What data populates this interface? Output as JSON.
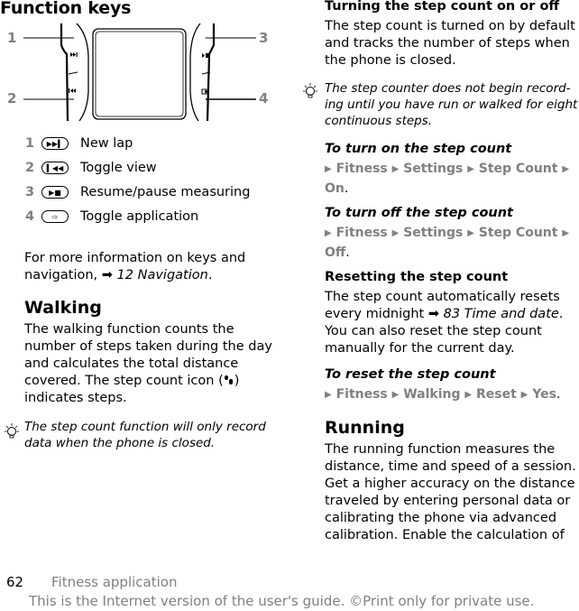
{
  "left": {
    "title": "Function keys",
    "diagram": {
      "callouts": [
        "1",
        "2",
        "3",
        "4"
      ],
      "icons": [
        "next-track-icon",
        "previous-track-icon",
        "play-pause-icon",
        "toggle-app-icon"
      ]
    },
    "keys": [
      {
        "num": "1",
        "icon": "next-track-icon",
        "glyph": "▶▶▍",
        "label": "New lap"
      },
      {
        "num": "2",
        "icon": "previous-track-icon",
        "glyph": "▍◀◀",
        "label": "Toggle view"
      },
      {
        "num": "3",
        "icon": "play-pause-icon",
        "glyph": "▶■",
        "label": "Resume/pause measuring"
      },
      {
        "num": "4",
        "icon": "toggle-app-icon",
        "glyph": "⇨",
        "label": "Toggle application"
      }
    ],
    "more_info": {
      "line1": "For more information on keys and",
      "line2_prefix": "navigation,",
      "arrow": "➡",
      "ref": "12 Navigation",
      "suffix": "."
    },
    "walking": {
      "heading": "Walking",
      "lines": [
        "The walking function counts the",
        "number of steps taken during the day",
        "and calculates the total distance"
      ],
      "line4_prefix": "covered. The step count icon (",
      "line4_suffix": ")",
      "line5": "indicates steps."
    },
    "tip": {
      "lines": [
        "The step count function will only record",
        "data when the phone is closed."
      ]
    }
  },
  "right": {
    "onoff": {
      "heading": "Turning the step count on or off",
      "lines": [
        "The step count is turned on by default",
        "and tracks the number of steps when",
        "the phone is closed."
      ]
    },
    "tip": {
      "lines": [
        "The step counter does not begin record-",
        "ing until you have run or walked for eight",
        "continuous steps."
      ]
    },
    "turn_on": {
      "heading": "To turn on the step count",
      "path": [
        "Fitness",
        "Settings",
        "Step Count"
      ],
      "final": "On"
    },
    "turn_off": {
      "heading": "To turn off the step count",
      "path": [
        "Fitness",
        "Settings",
        "Step Count"
      ],
      "final": "Off"
    },
    "resetting": {
      "heading": "Resetting the step count",
      "line1": "The step count automatically resets",
      "line2_prefix": "every midnight",
      "arrow": "➡",
      "ref": "83 Time and date",
      "line3": "You can also reset the step count",
      "line4": "manually for the current day."
    },
    "reset": {
      "heading": "To reset the step count",
      "path": [
        "Fitness",
        "Walking",
        "Reset",
        "Yes"
      ]
    },
    "running": {
      "heading": "Running",
      "lines": [
        "The running function measures the",
        "distance, time and speed of a session.",
        "Get a higher accuracy on the distance",
        "traveled by entering personal data or",
        "calibrating the phone via advanced",
        "calibration. Enable the calculation of"
      ]
    }
  },
  "footer": {
    "page_number": "62",
    "section": "Fitness application",
    "note": "This is the Internet version of the user's guide. ©Print only for private use."
  }
}
